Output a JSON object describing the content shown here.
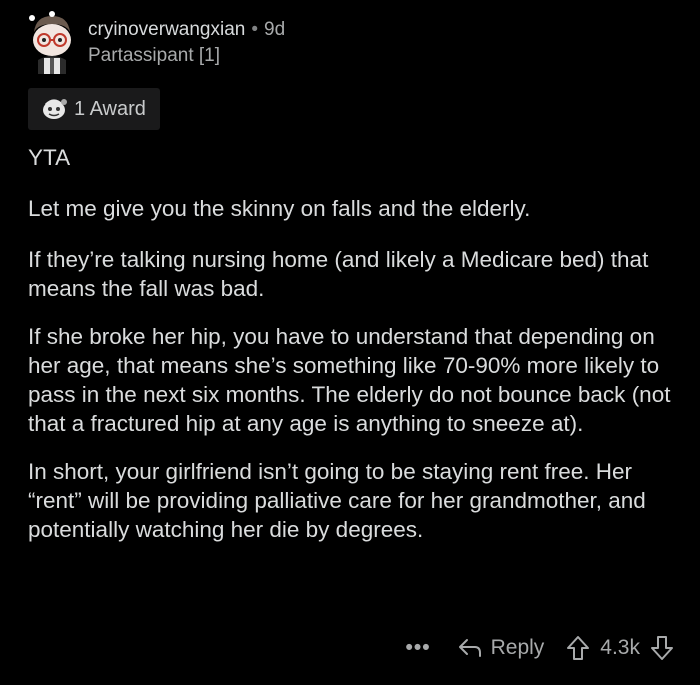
{
  "comment": {
    "username": "cryinoverwangxian",
    "separator": "•",
    "age": "9d",
    "flair": "Partassipant [1]",
    "award": "1 Award",
    "paragraphs": [
      "YTA",
      "Let me give you the skinny on falls and the elderly.",
      "If they’re talking nursing home (and likely a Medicare bed) that means the fall was bad.",
      "If she broke her hip, you have to understand that depending on her age, that means she’s something like 70-90% more likely to pass in the next six months. The elderly do not bounce back (not that a fractured hip at any age is anything to sneeze at).",
      "In short, your girlfriend isn’t going to be staying rent free. Her “rent” will be providing palliative care for her grandmother, and potentially watching her die by degrees."
    ],
    "actions": {
      "more": "•••",
      "reply": "Reply",
      "score": "4.3k"
    }
  },
  "icons": {
    "avatar": "snoo-avatar-icon",
    "award": "award-icon",
    "reply": "reply-arrow-icon",
    "upvote": "upvote-arrow-icon",
    "downvote": "downvote-arrow-icon"
  },
  "colors": {
    "background": "#000000",
    "text": "#d7dadc",
    "muted": "#a8aaab"
  }
}
